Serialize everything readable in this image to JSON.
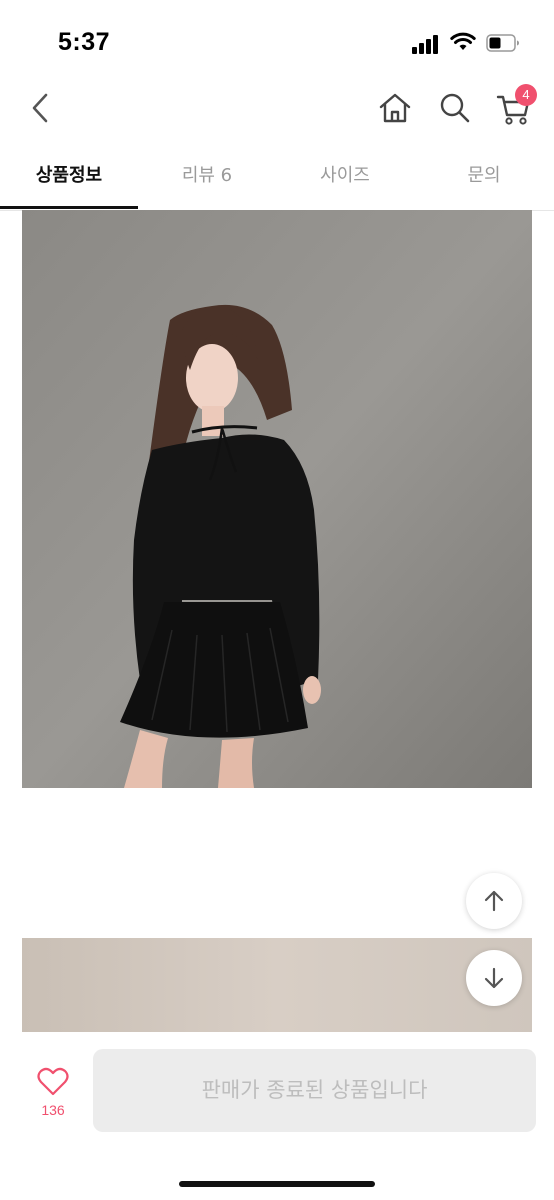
{
  "status_bar": {
    "time": "5:37"
  },
  "nav": {
    "cart_count": "4"
  },
  "tabs": [
    {
      "label": "상품정보",
      "active": true
    },
    {
      "label": "리뷰 6",
      "active": false
    },
    {
      "label": "사이즈",
      "active": false
    },
    {
      "label": "문의",
      "active": false
    }
  ],
  "bottom_bar": {
    "like_count": "136",
    "sold_out_label": "판매가 종료된 상품입니다"
  },
  "colors": {
    "accent": "#f0506e",
    "disabled_bg": "#ececec",
    "disabled_text": "#bdbdbd"
  }
}
